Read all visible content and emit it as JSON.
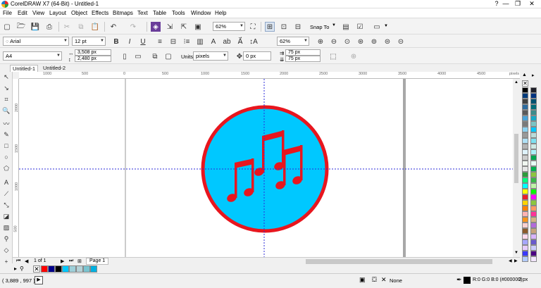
{
  "window": {
    "title": "CorelDRAW X7 (64-Bit) - Untitled-1",
    "help_btn": "?",
    "min_btn": "—",
    "max_btn": "❐",
    "close_btn": "✕"
  },
  "menu": [
    "File",
    "Edit",
    "View",
    "Layout",
    "Object",
    "Effects",
    "Bitmaps",
    "Text",
    "Table",
    "Tools",
    "Window",
    "Help"
  ],
  "toolbar": {
    "zoom_value": "62%",
    "snap_to_label": "Snap To"
  },
  "text_bar": {
    "font": "Arial",
    "size": "12 pt"
  },
  "property_bar": {
    "zoom_value": "62%",
    "page_size": "A4",
    "width": "3,508 px",
    "height": "2,480 px",
    "units_label": "Units:",
    "units_value": "pixels",
    "nudge": "0 px",
    "dup_x": "75 px",
    "dup_y": "75 px"
  },
  "tabs": [
    "Untitled-1",
    "Untitled-2"
  ],
  "ruler": {
    "h_ticks": [
      "1000",
      "500",
      "0",
      "500",
      "1000",
      "1500",
      "2000",
      "2500",
      "3000",
      "3500",
      "4000",
      "4500"
    ],
    "units": "pixels",
    "v_ticks": [
      "2000",
      "1500",
      "1000",
      "500"
    ]
  },
  "artwork": {
    "circle_fill": "#00c8ff",
    "circle_stroke": "#e8161e",
    "notes_color": "#e8161e"
  },
  "page_nav": {
    "page_count": "1 of 1",
    "page_tab": "Page 1"
  },
  "status": {
    "coords": "( 3,889 , 997 )",
    "fill_label": "None",
    "outline_label": "R:0 G:0 B:0 (#000000)",
    "outline_width": "2 px"
  },
  "palette_colors": [
    "#000000",
    "#1e1e28",
    "#003a7a",
    "#00337f",
    "#404040",
    "#005070",
    "#2d6b9e",
    "#006d7a",
    "#5a5a5a",
    "#3c8c8c",
    "#4aa3d8",
    "#18a9c6",
    "#7a7a7a",
    "#7ac4c4",
    "#8cd1f0",
    "#00c8ff",
    "#999999",
    "#b9dcd9",
    "#b0e0f5",
    "#7ee0f0",
    "#b3b3b3",
    "#cfe9e4",
    "#dff2fb",
    "#aaf0f8",
    "#cccccc",
    "#00a651",
    "#f0f6f0",
    "#e6fff6",
    "#e6e6e6",
    "#00b050",
    "#2d9b3c",
    "#8dc63f",
    "#00ff80",
    "#39b54a",
    "#00ffff",
    "#bff3a8",
    "#ffff00",
    "#00ff00",
    "#e81e2d",
    "#ff00ff",
    "#ffd200",
    "#8cc63f",
    "#ff7f00",
    "#ff9966",
    "#ffb3b3",
    "#ff3399",
    "#f7941d",
    "#d4b483",
    "#fbd0d0",
    "#b26bdb",
    "#8b5a2b",
    "#c7a27a",
    "#ffd9ec",
    "#d9b3ff",
    "#a6a6ff",
    "#6a5acd",
    "#e6ccff",
    "#ccccff",
    "#3a3aff",
    "#4b0082",
    "#b3ccff",
    "#f2e6ff"
  ],
  "doc_palette": [
    "#ff0000",
    "#00008b",
    "#000000",
    "#00c8ff",
    "#9ecfd9",
    "#b4d2d8",
    "#7ac4d0",
    "#00b0e0"
  ]
}
